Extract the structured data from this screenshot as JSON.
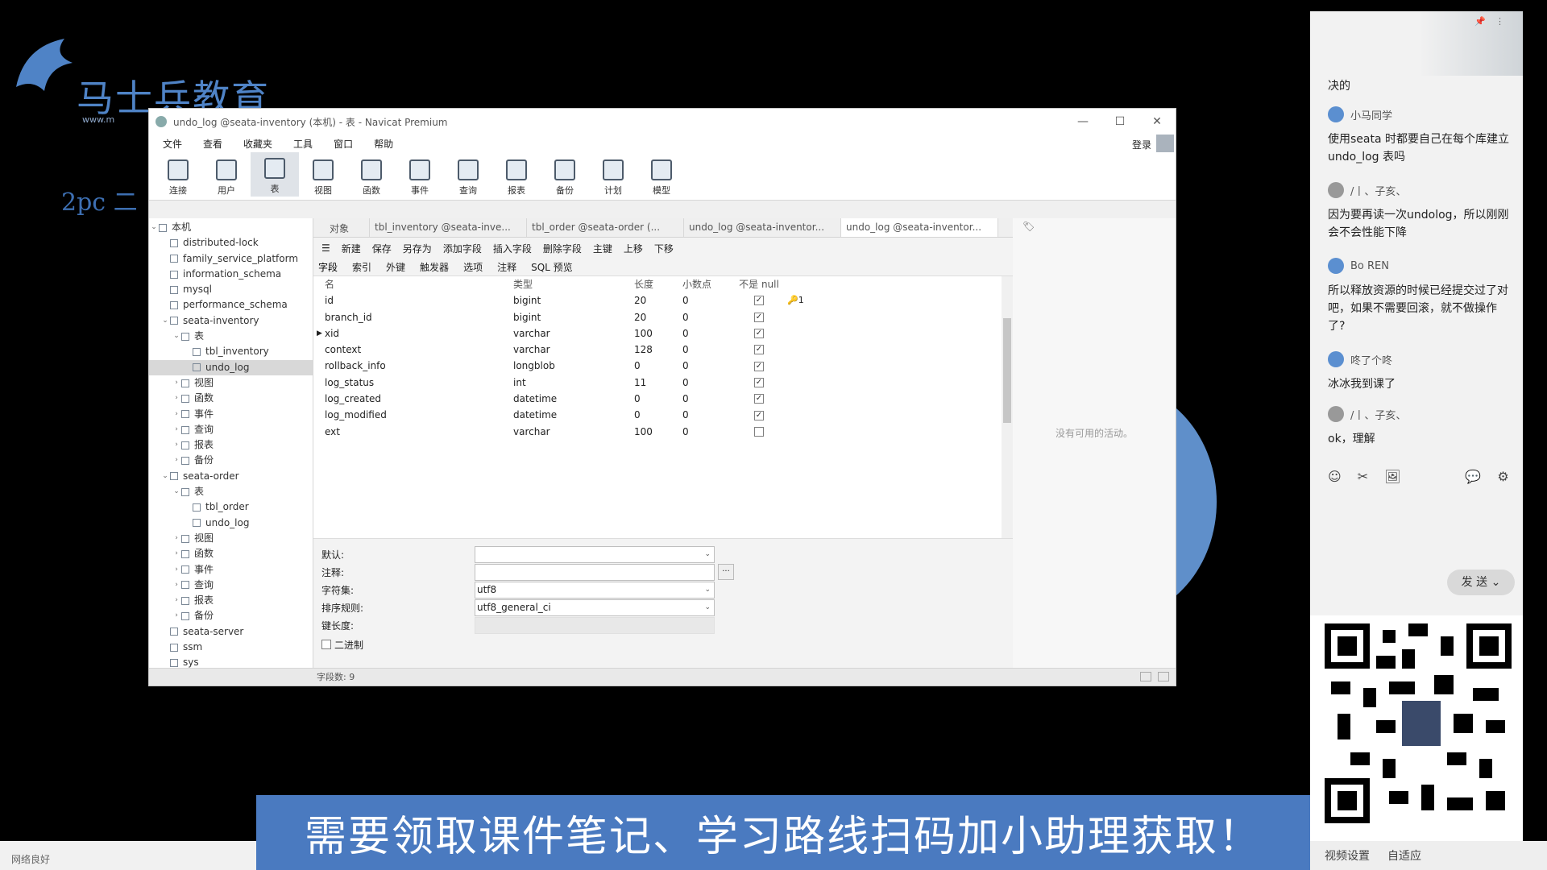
{
  "overlay": {
    "logo_text": "马士兵教育",
    "logo_url": "www.m",
    "side_note": "2pc 二",
    "banner_text": "需要领取课件笔记、学习路线扫码加小助理获取！",
    "bottom_status": "网络良好"
  },
  "window": {
    "title": "undo_log @seata-inventory (本机) - 表 - Navicat Premium",
    "controls": [
      "—",
      "☐",
      "✕"
    ],
    "login_label": "登录",
    "menus": [
      "文件",
      "查看",
      "收藏夹",
      "工具",
      "窗口",
      "帮助"
    ],
    "toolbar": [
      "连接",
      "用户",
      "表",
      "视图",
      "函数",
      "事件",
      "查询",
      "报表",
      "备份",
      "计划",
      "模型"
    ]
  },
  "tree": [
    {
      "label": "本机",
      "level": 0,
      "arrow": "⌄",
      "sel": false
    },
    {
      "label": "distributed-lock",
      "level": 1,
      "arrow": "",
      "sel": false
    },
    {
      "label": "family_service_platform",
      "level": 1,
      "arrow": "",
      "sel": false
    },
    {
      "label": "information_schema",
      "level": 1,
      "arrow": "",
      "sel": false
    },
    {
      "label": "mysql",
      "level": 1,
      "arrow": "",
      "sel": false
    },
    {
      "label": "performance_schema",
      "level": 1,
      "arrow": "",
      "sel": false
    },
    {
      "label": "seata-inventory",
      "level": 1,
      "arrow": "⌄",
      "sel": false
    },
    {
      "label": "表",
      "level": 2,
      "arrow": "⌄",
      "sel": false
    },
    {
      "label": "tbl_inventory",
      "level": 3,
      "arrow": "",
      "sel": false
    },
    {
      "label": "undo_log",
      "level": 3,
      "arrow": "",
      "sel": true
    },
    {
      "label": "视图",
      "level": 2,
      "arrow": "›",
      "sel": false
    },
    {
      "label": "函数",
      "level": 2,
      "arrow": "›",
      "sel": false
    },
    {
      "label": "事件",
      "level": 2,
      "arrow": "›",
      "sel": false
    },
    {
      "label": "查询",
      "level": 2,
      "arrow": "›",
      "sel": false
    },
    {
      "label": "报表",
      "level": 2,
      "arrow": "›",
      "sel": false
    },
    {
      "label": "备份",
      "level": 2,
      "arrow": "›",
      "sel": false
    },
    {
      "label": "seata-order",
      "level": 1,
      "arrow": "⌄",
      "sel": false
    },
    {
      "label": "表",
      "level": 2,
      "arrow": "⌄",
      "sel": false
    },
    {
      "label": "tbl_order",
      "level": 3,
      "arrow": "",
      "sel": false
    },
    {
      "label": "undo_log",
      "level": 3,
      "arrow": "",
      "sel": false
    },
    {
      "label": "视图",
      "level": 2,
      "arrow": "›",
      "sel": false
    },
    {
      "label": "函数",
      "level": 2,
      "arrow": "›",
      "sel": false
    },
    {
      "label": "事件",
      "level": 2,
      "arrow": "›",
      "sel": false
    },
    {
      "label": "查询",
      "level": 2,
      "arrow": "›",
      "sel": false
    },
    {
      "label": "报表",
      "level": 2,
      "arrow": "›",
      "sel": false
    },
    {
      "label": "备份",
      "level": 2,
      "arrow": "›",
      "sel": false
    },
    {
      "label": "seata-server",
      "level": 1,
      "arrow": "",
      "sel": false
    },
    {
      "label": "ssm",
      "level": 1,
      "arrow": "",
      "sel": false
    },
    {
      "label": "sys",
      "level": 1,
      "arrow": "",
      "sel": false
    }
  ],
  "tabs": {
    "object": "对象",
    "items": [
      "tbl_inventory @seata-inve...",
      "tbl_order @seata-order (...",
      "undo_log @seata-inventor...",
      "undo_log @seata-inventor..."
    ]
  },
  "design_toolbar": [
    "☰",
    "新建",
    "保存",
    "另存为",
    "添加字段",
    "插入字段",
    "删除字段",
    "主键",
    "上移",
    "下移"
  ],
  "subtabs": [
    "字段",
    "索引",
    "外键",
    "触发器",
    "选项",
    "注释",
    "SQL 预览"
  ],
  "grid": {
    "headers": [
      "名",
      "类型",
      "长度",
      "小数点",
      "不是 null",
      ""
    ],
    "rows": [
      {
        "name": "id",
        "type": "bigint",
        "len": "20",
        "dec": "0",
        "notnull": true,
        "key": "🔑1",
        "mark": ""
      },
      {
        "name": "branch_id",
        "type": "bigint",
        "len": "20",
        "dec": "0",
        "notnull": true,
        "key": "",
        "mark": ""
      },
      {
        "name": "xid",
        "type": "varchar",
        "len": "100",
        "dec": "0",
        "notnull": true,
        "key": "",
        "mark": "▶"
      },
      {
        "name": "context",
        "type": "varchar",
        "len": "128",
        "dec": "0",
        "notnull": true,
        "key": "",
        "mark": ""
      },
      {
        "name": "rollback_info",
        "type": "longblob",
        "len": "0",
        "dec": "0",
        "notnull": true,
        "key": "",
        "mark": ""
      },
      {
        "name": "log_status",
        "type": "int",
        "len": "11",
        "dec": "0",
        "notnull": true,
        "key": "",
        "mark": ""
      },
      {
        "name": "log_created",
        "type": "datetime",
        "len": "0",
        "dec": "0",
        "notnull": true,
        "key": "",
        "mark": ""
      },
      {
        "name": "log_modified",
        "type": "datetime",
        "len": "0",
        "dec": "0",
        "notnull": true,
        "key": "",
        "mark": ""
      },
      {
        "name": "ext",
        "type": "varchar",
        "len": "100",
        "dec": "0",
        "notnull": false,
        "key": "",
        "mark": ""
      }
    ]
  },
  "props": {
    "default_label": "默认:",
    "comment_label": "注释:",
    "charset_label": "字符集:",
    "charset_value": "utf8",
    "collation_label": "排序规则:",
    "collation_value": "utf8_general_ci",
    "keylen_label": "键长度:",
    "binary_label": "二进制",
    "more_btn": "..."
  },
  "info_panel": {
    "message": "没有可用的活动。",
    "tool": "🏷"
  },
  "status": {
    "fields": "字段数: 9"
  },
  "chat": {
    "prev": "决的",
    "messages": [
      {
        "user": "小马同学",
        "text": "使用seata 时都要自己在每个库建立undo_log 表吗",
        "av": "blue"
      },
      {
        "user": "/丨、子亥、",
        "text": "因为要再读一次undolog，所以刚刚会不会性能下降",
        "av": "gray"
      },
      {
        "user": "Bo REN",
        "text": "所以释放资源的时候已经提交过了对吧，如果不需要回滚，就不做操作了?",
        "av": "blue"
      },
      {
        "user": "咚了个咚",
        "text": "冰冰我到课了",
        "av": "blue"
      },
      {
        "user": "/丨、子亥、",
        "text": "ok，理解",
        "av": "gray"
      }
    ],
    "tools": [
      "☺",
      "✂",
      "🖼",
      "",
      "",
      "💬",
      "⚙"
    ],
    "send": "发 送  ⌄",
    "bottom": [
      "视频设置",
      "自适应"
    ]
  }
}
